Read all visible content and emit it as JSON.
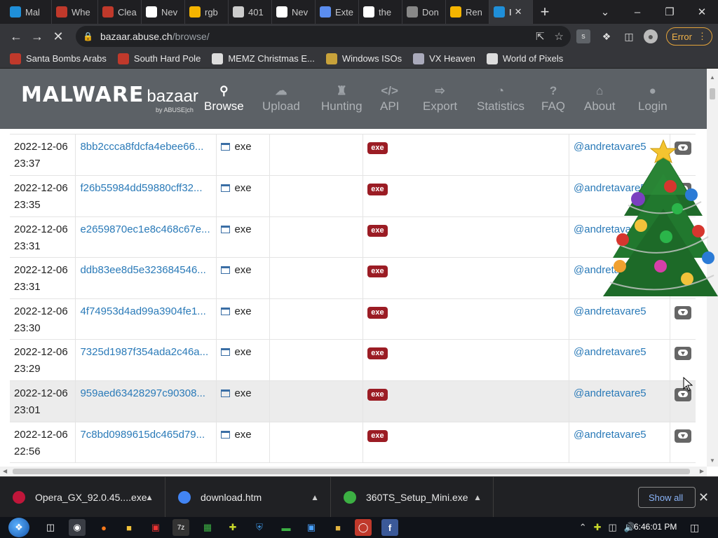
{
  "browser": {
    "tabs": [
      {
        "label": "Mal",
        "icon": "a-logo-icon",
        "color": "#1f8fd9"
      },
      {
        "label": "Whe",
        "icon": "red-square-icon",
        "color": "#c0392b"
      },
      {
        "label": "Clea",
        "icon": "red-square-icon",
        "color": "#c0392b"
      },
      {
        "label": "Nev",
        "icon": "github-icon",
        "color": "#ffffff"
      },
      {
        "label": "rgb",
        "icon": "drive-icon",
        "color": "#f4b400"
      },
      {
        "label": "401",
        "icon": "steam-icon",
        "color": "#cccccc"
      },
      {
        "label": "Nev",
        "icon": "github-icon",
        "color": "#ffffff"
      },
      {
        "label": "Exte",
        "icon": "puzzle-icon",
        "color": "#5b8def"
      },
      {
        "label": "the",
        "icon": "google-icon",
        "color": "#ffffff"
      },
      {
        "label": "Don",
        "icon": "car-icon",
        "color": "#888888"
      },
      {
        "label": "Ren",
        "icon": "drive-icon",
        "color": "#f4b400"
      },
      {
        "label": "I",
        "icon": "a-logo-icon",
        "color": "#1f8fd9"
      }
    ],
    "url_host": "bazaar.abuse.ch",
    "url_path": "/browse/",
    "error_label": "Error",
    "bookmarks": [
      {
        "label": "Santa Bombs Arabs",
        "icon": "blood-drop-icon"
      },
      {
        "label": "South Hard Pole",
        "icon": "virus-icon"
      },
      {
        "label": "MEMZ Christmas E...",
        "icon": "image-icon"
      },
      {
        "label": "Windows ISOs",
        "icon": "figure-icon"
      },
      {
        "label": "VX Heaven",
        "icon": "shield-icon"
      },
      {
        "label": "World of Pixels",
        "icon": "pixel-icon"
      }
    ]
  },
  "site": {
    "logo_main": "MALWARE",
    "logo_sub": "bazaar",
    "logo_by": "by ABUSE|ch",
    "menu": [
      {
        "label": "Browse",
        "icon": "search-icon",
        "active": true
      },
      {
        "label": "Upload",
        "icon": "cloud-upload-icon"
      },
      {
        "label": "Hunting",
        "icon": "tower-icon"
      },
      {
        "label": "API",
        "icon": "code-icon"
      },
      {
        "label": "Export",
        "icon": "export-icon"
      },
      {
        "label": "Statistics",
        "icon": "pie-chart-icon"
      },
      {
        "label": "FAQ",
        "icon": "question-icon"
      },
      {
        "label": "About",
        "icon": "building-icon"
      },
      {
        "label": "Login",
        "icon": "user-icon"
      }
    ]
  },
  "table": {
    "rows": [
      {
        "date": "2022-12-06",
        "time": "23:37",
        "hash": "8bb2ccca8fdcfa4ebee66...",
        "type": "exe",
        "tag": "exe",
        "reporter": "@andretavare5"
      },
      {
        "date": "2022-12-06",
        "time": "23:35",
        "hash": "f26b55984dd59880cff32...",
        "type": "exe",
        "tag": "exe",
        "reporter": "@andretavare5"
      },
      {
        "date": "2022-12-06",
        "time": "23:31",
        "hash": "e2659870ec1e8c468c67e...",
        "type": "exe",
        "tag": "exe",
        "reporter": "@andretavare5"
      },
      {
        "date": "2022-12-06",
        "time": "23:31",
        "hash": "ddb83ee8d5e323684546...",
        "type": "exe",
        "tag": "exe",
        "reporter": "@andretavare5"
      },
      {
        "date": "2022-12-06",
        "time": "23:30",
        "hash": "4f74953d4ad99a3904fe1...",
        "type": "exe",
        "tag": "exe",
        "reporter": "@andretavare5"
      },
      {
        "date": "2022-12-06",
        "time": "23:29",
        "hash": "7325d1987f354ada2c46a...",
        "type": "exe",
        "tag": "exe",
        "reporter": "@andretavare5"
      },
      {
        "date": "2022-12-06",
        "time": "23:01",
        "hash": "959aed63428297c90308...",
        "type": "exe",
        "tag": "exe",
        "reporter": "@andretavare5",
        "highlight": true
      },
      {
        "date": "2022-12-06",
        "time": "22:56",
        "hash": "7c8bd0989615dc465d79...",
        "type": "exe",
        "tag": "exe",
        "reporter": "@andretavare5"
      }
    ]
  },
  "downloads": {
    "items": [
      {
        "name": "Opera_GX_92.0.45....exe",
        "icon": "opera-icon",
        "color": "#c0163a"
      },
      {
        "name": "download.htm",
        "icon": "chrome-icon",
        "color": "#4285f4"
      },
      {
        "name": "360TS_Setup_Mini.exe",
        "icon": "360-icon",
        "color": "#3cb043"
      }
    ],
    "show_all": "Show all"
  },
  "taskbar": {
    "time": "6:46:01 PM"
  }
}
